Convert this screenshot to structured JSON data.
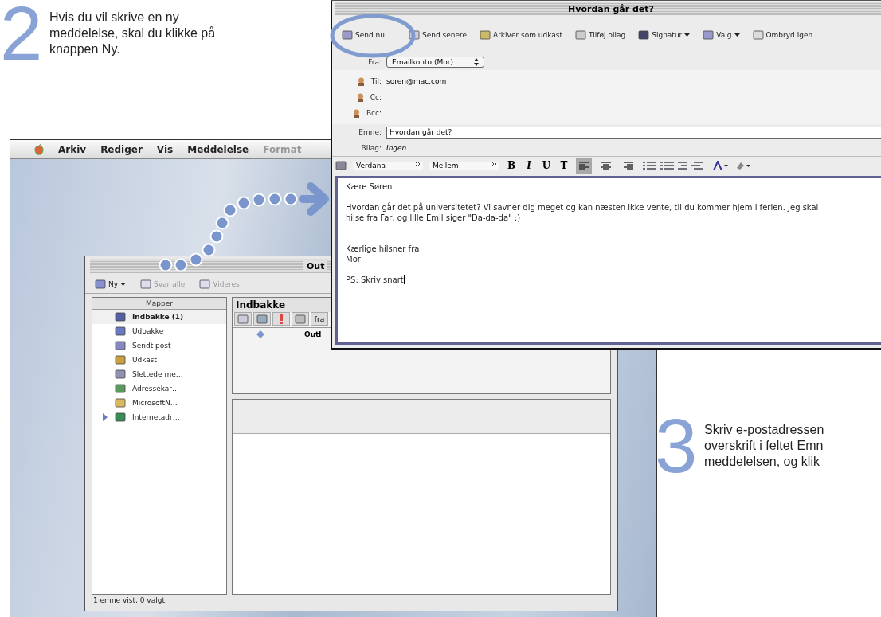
{
  "steps": [
    {
      "number": "2",
      "lines": [
        "Hvis du vil skrive en ny",
        "meddelelse, skal du klikke på",
        "knappen Ny."
      ]
    },
    {
      "number": "3",
      "lines": [
        "Skriv e-postadressen",
        "overskrift i feltet Emn",
        "meddelelsen, og klik"
      ]
    }
  ],
  "menu_bar": {
    "items": [
      {
        "label": "Arkiv",
        "disabled": false
      },
      {
        "label": "Rediger",
        "disabled": false
      },
      {
        "label": "Vis",
        "disabled": false
      },
      {
        "label": "Meddelelse",
        "disabled": false
      },
      {
        "label": "Format",
        "disabled": true
      }
    ]
  },
  "main_window": {
    "title": "Out",
    "toolbar": [
      {
        "label": "Ny",
        "kind": "dropdown",
        "disabled": false
      },
      {
        "label": "Svar alle",
        "kind": "button",
        "disabled": true
      },
      {
        "label": "Videres",
        "kind": "button",
        "disabled": true
      }
    ],
    "folders_header": "Mapper",
    "folders": [
      {
        "label": "Indbakke (1)",
        "unread": true,
        "selected": true
      },
      {
        "label": "Udbakke",
        "unread": false,
        "selected": false
      },
      {
        "label": "Sendt post",
        "unread": false,
        "selected": false
      },
      {
        "label": "Udkast",
        "unread": false,
        "selected": false
      },
      {
        "label": "Slettede me…",
        "unread": false,
        "selected": false
      },
      {
        "label": "Adressekar…",
        "unread": false,
        "selected": false
      },
      {
        "label": "MicrosoftN…",
        "unread": false,
        "selected": false
      },
      {
        "label": "Internetadr…",
        "unread": false,
        "selected": false,
        "expanded": false
      }
    ],
    "list_title": "Indbakke",
    "column_label": "fra",
    "rows": [
      {
        "from": "Outl"
      }
    ],
    "status_bar": "1 emne vist, 0 valgt"
  },
  "compose_window": {
    "title": "Hvordan går det?",
    "toolbar": [
      {
        "label": "Send nu",
        "kind": "button"
      },
      {
        "label": "Send senere",
        "kind": "button"
      },
      {
        "label": "Arkiver som udkast",
        "kind": "button"
      },
      {
        "label": "Tilføj bilag",
        "kind": "button"
      },
      {
        "label": "Signatur",
        "kind": "dropdown"
      },
      {
        "label": "Valg",
        "kind": "dropdown"
      },
      {
        "label": "Ombryd igen",
        "kind": "button"
      }
    ],
    "from_label": "Fra:",
    "from_value": "Emailkonto (Mor)",
    "recipients": [
      {
        "label": "Til:",
        "value": "soren@mac.com"
      },
      {
        "label": "Cc:"
      },
      {
        "label": "Bcc:"
      }
    ],
    "subject_label": "Emne:",
    "subject_value": "Hvordan går det?",
    "attachments_label": "Bilag:",
    "attachments_value": "Ingen",
    "format_bar": {
      "font": "Verdana",
      "size": "Mellem",
      "styles": [
        "B",
        "I",
        "U",
        "T"
      ],
      "alignments": [
        {
          "selected": true
        },
        {
          "selected": false
        },
        {
          "selected": false
        }
      ]
    },
    "body": [
      [
        "Kære Søren"
      ],
      [
        "Hvordan går det på universitetet? Vi savner dig meget og kan næsten ikke vente, til du kommer hjem i ferien. Jeg skal hilse fra Far, og lille Emil siger \"Da-da-da\" :)"
      ],
      [
        "Kærlige hilsner fra",
        "Mor"
      ],
      [
        "PS: Skriv snart"
      ]
    ]
  }
}
